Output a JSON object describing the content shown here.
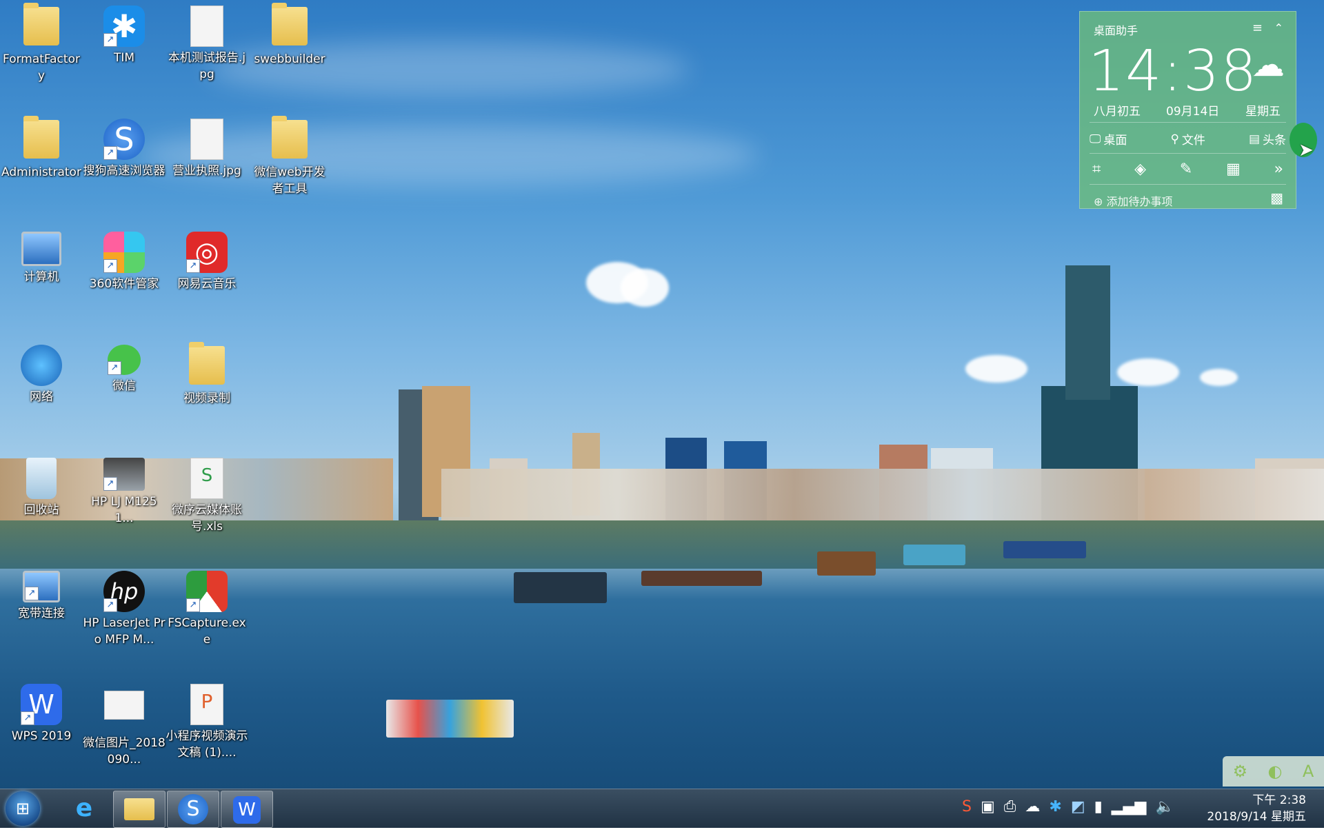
{
  "desktop_icons": [
    {
      "label": "FormatFactory",
      "kind": "folder"
    },
    {
      "label": "TIM",
      "kind": "app"
    },
    {
      "label": "本机测试报告.jpg",
      "kind": "image"
    },
    {
      "label": "swebbuilder",
      "kind": "folder"
    },
    {
      "label": "Administrator",
      "kind": "user"
    },
    {
      "label": "搜狗高速浏览器",
      "kind": "app"
    },
    {
      "label": "营业执照.jpg",
      "kind": "image"
    },
    {
      "label": "微信web开发者工具",
      "kind": "folder"
    },
    {
      "label": "计算机",
      "kind": "computer"
    },
    {
      "label": "360软件管家",
      "kind": "app"
    },
    {
      "label": "网易云音乐",
      "kind": "app"
    },
    {
      "label": "网络",
      "kind": "network"
    },
    {
      "label": "微信",
      "kind": "app"
    },
    {
      "label": "视频录制",
      "kind": "folder"
    },
    {
      "label": "回收站",
      "kind": "recycle"
    },
    {
      "label": "HP LJ M1251...",
      "kind": "printer"
    },
    {
      "label": "微序云媒体账号.xls",
      "kind": "spreadsheet"
    },
    {
      "label": "宽带连接",
      "kind": "network"
    },
    {
      "label": "HP LaserJet Pro MFP M...",
      "kind": "app"
    },
    {
      "label": "FSCapture.exe",
      "kind": "app"
    },
    {
      "label": "WPS 2019",
      "kind": "app"
    },
    {
      "label": "微信图片_2018090...",
      "kind": "image"
    },
    {
      "label": "小程序视频演示文稿 (1)....",
      "kind": "presentation"
    }
  ],
  "widget": {
    "title": "桌面助手",
    "time": "14:38",
    "lunar": "八月初五",
    "date": "09月14日",
    "weekday": "星期五",
    "links": [
      "桌面",
      "文件",
      "头条"
    ],
    "add_todo": "添加待办事项"
  },
  "taskbar": {
    "clock_time": "下午 2:38",
    "clock_date": "2018/9/14 星期五"
  },
  "ime": {
    "mode_char": "A"
  },
  "colors": {
    "widget_green": "#6ebe78",
    "taskbar": "#203244",
    "sky": "#4f9ad6"
  }
}
